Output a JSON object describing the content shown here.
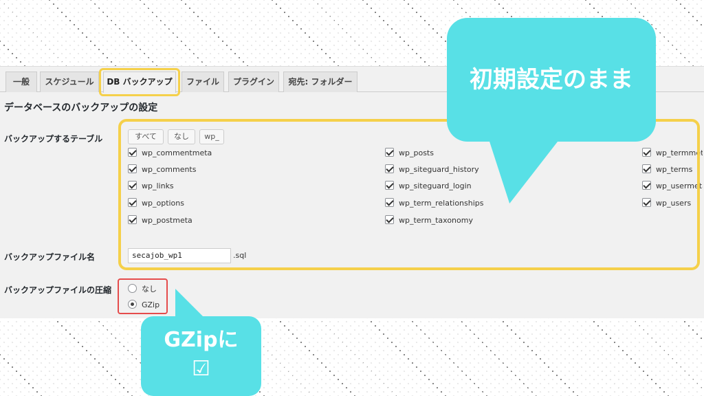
{
  "tabs": [
    {
      "label": "一般"
    },
    {
      "label": "スケジュール"
    },
    {
      "label": "DB バックアップ"
    },
    {
      "label": "ファイル"
    },
    {
      "label": "プラグイン"
    },
    {
      "label": "宛先: フォルダー"
    }
  ],
  "section_title": "データベースのバックアップの設定",
  "tables_label": "バックアップするテーブル",
  "buttons": {
    "all": "すべて",
    "none": "なし",
    "wp": "wp_"
  },
  "tables": [
    "wp_commentmeta",
    "wp_comments",
    "wp_links",
    "wp_options",
    "wp_postmeta",
    "wp_posts",
    "wp_siteguard_history",
    "wp_siteguard_login",
    "wp_term_relationships",
    "wp_term_taxonomy",
    "wp_termmeta",
    "wp_terms",
    "wp_usermeta",
    "wp_users"
  ],
  "filename_label": "バックアップファイル名",
  "filename_value": "secajob_wp1",
  "filename_suffix": ".sql",
  "compression_label": "バックアップファイルの圧縮",
  "compression_options": [
    "なし",
    "GZip"
  ],
  "compression_selected": "GZip",
  "callout_main": "初期設定のまま",
  "callout_small_line1": "GZipに",
  "callout_small_line2": "☑",
  "colors": {
    "callout": "#58e0e6",
    "highlight_yellow": "#f5d04a",
    "highlight_red": "#e54b4b"
  }
}
